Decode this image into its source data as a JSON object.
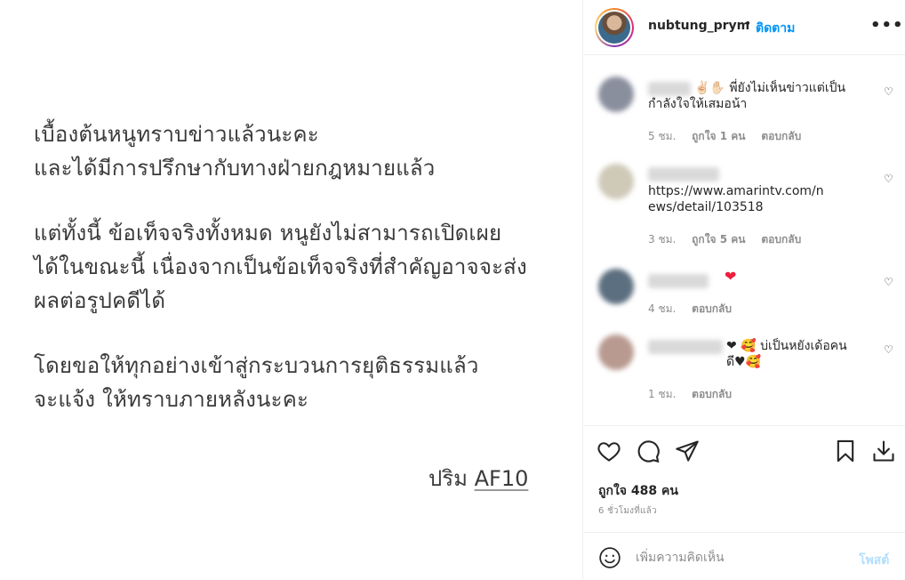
{
  "post": {
    "lines": [
      "เบื้องต้นหนูทราบข่าวแล้วนะคะ",
      "และได้มีการปรึกษากับทางฝ่ายกฎหมายแล้ว",
      "แต่ทั้งนี้ ข้อเท็จจริงทั้งหมด หนูยังไม่สามารถเปิดเผย",
      "ได้ในขณะนี้ เนื่องจากเป็นข้อเท็จจริงที่สำคัญอาจจะส่ง",
      "ผลต่อรูปคดีได้",
      "โดยขอให้ทุกอย่างเข้าสู่กระบวนการยุติธรรมแล้ว",
      "จะแจ้ง ให้ทราบภายหลังนะคะ"
    ],
    "signature_name": "ปริม",
    "signature_tag": "AF10"
  },
  "header": {
    "username": "nubtung_prym",
    "separator": "•",
    "follow_label": "ติดตาม",
    "more_label": "•••"
  },
  "comments": [
    {
      "text": "✌🏻✋🏻 พี่ยังไม่เห็นข่าวแต่เป็นกำลังใจให้เสมอน้า",
      "time": "5 ชม.",
      "likes": "ถูกใจ 1 คน",
      "reply": "ตอบกลับ"
    },
    {
      "text": "https://www.amarintv.com/news/detail/103518",
      "time": "3 ชม.",
      "likes": "ถูกใจ 5 คน",
      "reply": "ตอบกลับ"
    },
    {
      "text": "❤",
      "time": "4 ชม.",
      "reply": "ตอบกลับ"
    },
    {
      "text": "❤ 🥰 บ่เป็นหยังเด้อคนดี♥🥰",
      "time": "1 ชม.",
      "reply": "ตอบกลับ"
    }
  ],
  "likes_count": "ถูกใจ 488 คน",
  "posted_time": "6 ชั่วโมงที่แล้ว",
  "add_comment": {
    "placeholder": "เพิ่มความคิดเห็น",
    "post_label": "โพสต์"
  },
  "icons": {
    "like": "heart-icon",
    "comment": "comment-bubble-icon",
    "share": "paper-plane-icon",
    "save": "bookmark-icon",
    "download": "download-icon",
    "emoji": "smiley-icon"
  }
}
